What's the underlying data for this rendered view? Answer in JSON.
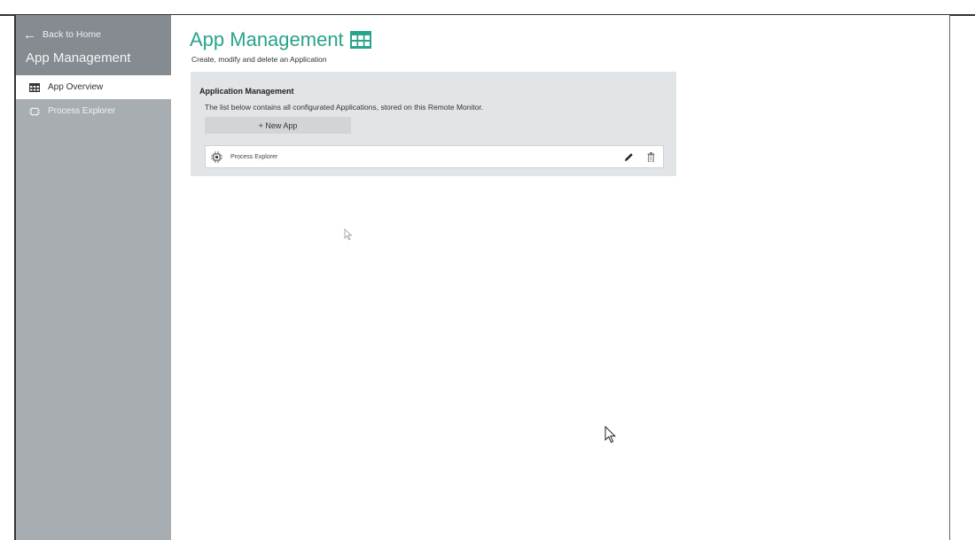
{
  "sidebar": {
    "back_label": "Back to Home",
    "title": "App Management",
    "items": [
      {
        "label": "App Overview",
        "icon": "app-grid-icon",
        "active": true
      },
      {
        "label": "Process Explorer",
        "icon": "chip-icon",
        "active": false
      }
    ]
  },
  "header": {
    "title": "App Management",
    "icon": "app-grid-icon",
    "subtitle": "Create, modify and delete an Application"
  },
  "panel": {
    "heading": "Application Management",
    "description": "The list below contains all configurated Applications, stored on this Remote Monitor.",
    "new_button_label": "+ New App",
    "apps": [
      {
        "name": "Process Explorer",
        "icon": "chip-icon"
      }
    ]
  },
  "colors": {
    "accent": "#2aa38a",
    "sidebar_bg": "#a8adb2",
    "sidebar_header_bg": "#858b91",
    "panel_bg": "#e2e5e7"
  }
}
